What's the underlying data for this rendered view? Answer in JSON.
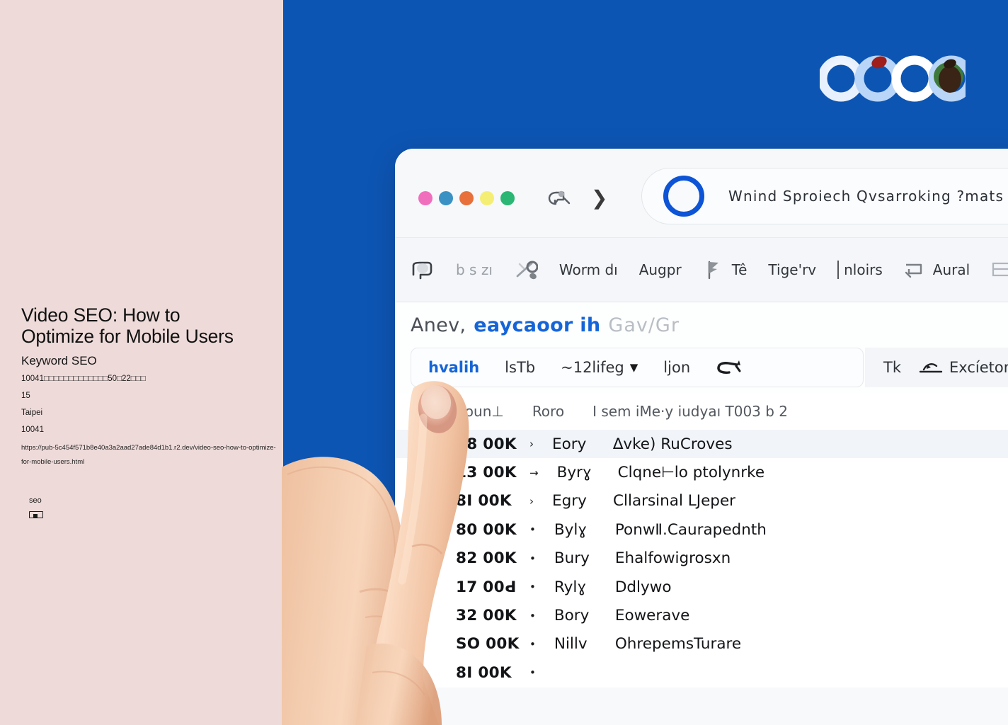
{
  "colors": {
    "panel_bg": "#eedbd9",
    "backdrop_blue": "#0d55b3",
    "accent_blue": "#1565d8",
    "ring_blue": "#0d55d6",
    "chrome_bg": "#f6f8fa",
    "row_alt": "#f1f4f8"
  },
  "article": {
    "title": "Video SEO: How to Optimize for Mobile Users",
    "subtitle": "Keyword SEO",
    "meta_line": "10041□□□□□□□□□□□□□50□22□□□",
    "number": "15",
    "city": "Taipei",
    "postal": "10041",
    "url": "https://pub-5c454f571b8e40a3a2aad27ade84d1b1.r2.dev/video-seo-how-to-optimize-for-mobile-users.html",
    "tag": "seo"
  },
  "logo": {
    "name": "abstract-rings-logo",
    "ring_colors": [
      "#ffffff",
      "#cfe2fb",
      "#ffffff",
      "#cfe2fb"
    ],
    "accent_colors": [
      "#b3201e",
      "#2f1b10",
      "#3a7d3a"
    ]
  },
  "browser": {
    "window_dots": [
      {
        "name": "dot-pink",
        "color": "#f06fbd"
      },
      {
        "name": "dot-blue",
        "color": "#3a92c4"
      },
      {
        "name": "dot-orange",
        "color": "#e8703a"
      },
      {
        "name": "dot-yellow",
        "color": "#f4ef74"
      },
      {
        "name": "dot-green",
        "color": "#2bb673"
      }
    ],
    "nav": {
      "back_icon": "back-speech-glyph-icon",
      "forward_icon": "chevron-right-icon"
    },
    "address_bar": {
      "ring_icon": "blue-ring-icon",
      "value": "Wnind Sproiech Qvsarroking ?mats Qitl",
      "trailing": "··"
    },
    "toolbar": [
      {
        "name": "toolbar-icon-1",
        "type": "icon",
        "glyph": "tag-outline-icon",
        "label": ""
      },
      {
        "name": "toolbar-item-2",
        "type": "text",
        "glyph": "",
        "label": "b s zı",
        "muted": true
      },
      {
        "name": "toolbar-icon-3",
        "type": "icon",
        "glyph": "scissors-icon",
        "label": ""
      },
      {
        "name": "toolbar-item-4",
        "type": "text",
        "glyph": "",
        "label": "Worm dı"
      },
      {
        "name": "toolbar-item-5",
        "type": "text",
        "glyph": "",
        "label": "Augpr"
      },
      {
        "name": "toolbar-item-6",
        "type": "text",
        "glyph": "flag-icon",
        "label": "Tê"
      },
      {
        "name": "toolbar-item-7",
        "type": "text",
        "glyph": "",
        "label": "Tige'rv"
      },
      {
        "name": "toolbar-item-8",
        "type": "text",
        "glyph": "divider",
        "label": "nloirs"
      },
      {
        "name": "toolbar-item-9",
        "type": "text",
        "glyph": "bracket-icon",
        "label": "Aural"
      }
    ],
    "headline": {
      "part_dark": "Anev,",
      "part_blue": "eaycaoor ih",
      "part_grey": "Gav/Gr"
    },
    "filters": [
      {
        "name": "filter-tab-active",
        "label": "hvalih",
        "active": true
      },
      {
        "name": "filter-tab-2",
        "label": "lsTb",
        "active": false
      },
      {
        "name": "filter-dropdown",
        "label": "~12lifeg",
        "caret": "▼",
        "active": false
      },
      {
        "name": "filter-tab-4",
        "label": "ljon",
        "active": false
      },
      {
        "name": "filter-icon-5",
        "label": "",
        "glyph": "cursor-icon",
        "active": false
      }
    ],
    "filters_right": [
      {
        "name": "filter-right-1",
        "label": "Tk"
      },
      {
        "name": "filter-right-2",
        "label": "Excíetonı",
        "glyph": "share-icon"
      }
    ],
    "column_headers": [
      "Hly oun⊥",
      "Roro",
      "I sem iMe·y iudyaı T003 b 2"
    ],
    "rows": [
      {
        "volume": "68 00K",
        "arrow": "›",
        "code": "Eory",
        "desc": "∆vke) RuCroves",
        "alt": true
      },
      {
        "volume": "13 00K",
        "arrow": "→",
        "code": "Byrɣ",
        "desc": "Clqne⊢lo ptolynrke",
        "alt": false
      },
      {
        "volume": "8I 00K",
        "arrow": "›",
        "code": "Egry",
        "desc": "Cllarsinal LJeper",
        "alt": false
      },
      {
        "volume": "80 00K",
        "arrow": "•",
        "code": "Bylɣ",
        "desc": "PonwⅡ.Caurapednth",
        "alt": false
      },
      {
        "volume": "82 00K",
        "arrow": "•",
        "code": "Bury",
        "desc": "Ehalfowigrosxn",
        "alt": false
      },
      {
        "volume": "17 00Ԁ",
        "arrow": "•",
        "code": "Rylɣ",
        "desc": "Ddlywo",
        "alt": false
      },
      {
        "volume": "32 00K",
        "arrow": "•",
        "code": "Bory",
        "desc": "Eowerave",
        "alt": false
      },
      {
        "volume": "SO 00K",
        "arrow": "•",
        "code": "Nillv",
        "desc": "OhrepemsTurare",
        "alt": false
      },
      {
        "volume": "8Ӏ 00K",
        "arrow": "•",
        "code": "",
        "desc": "",
        "alt": false
      }
    ]
  }
}
